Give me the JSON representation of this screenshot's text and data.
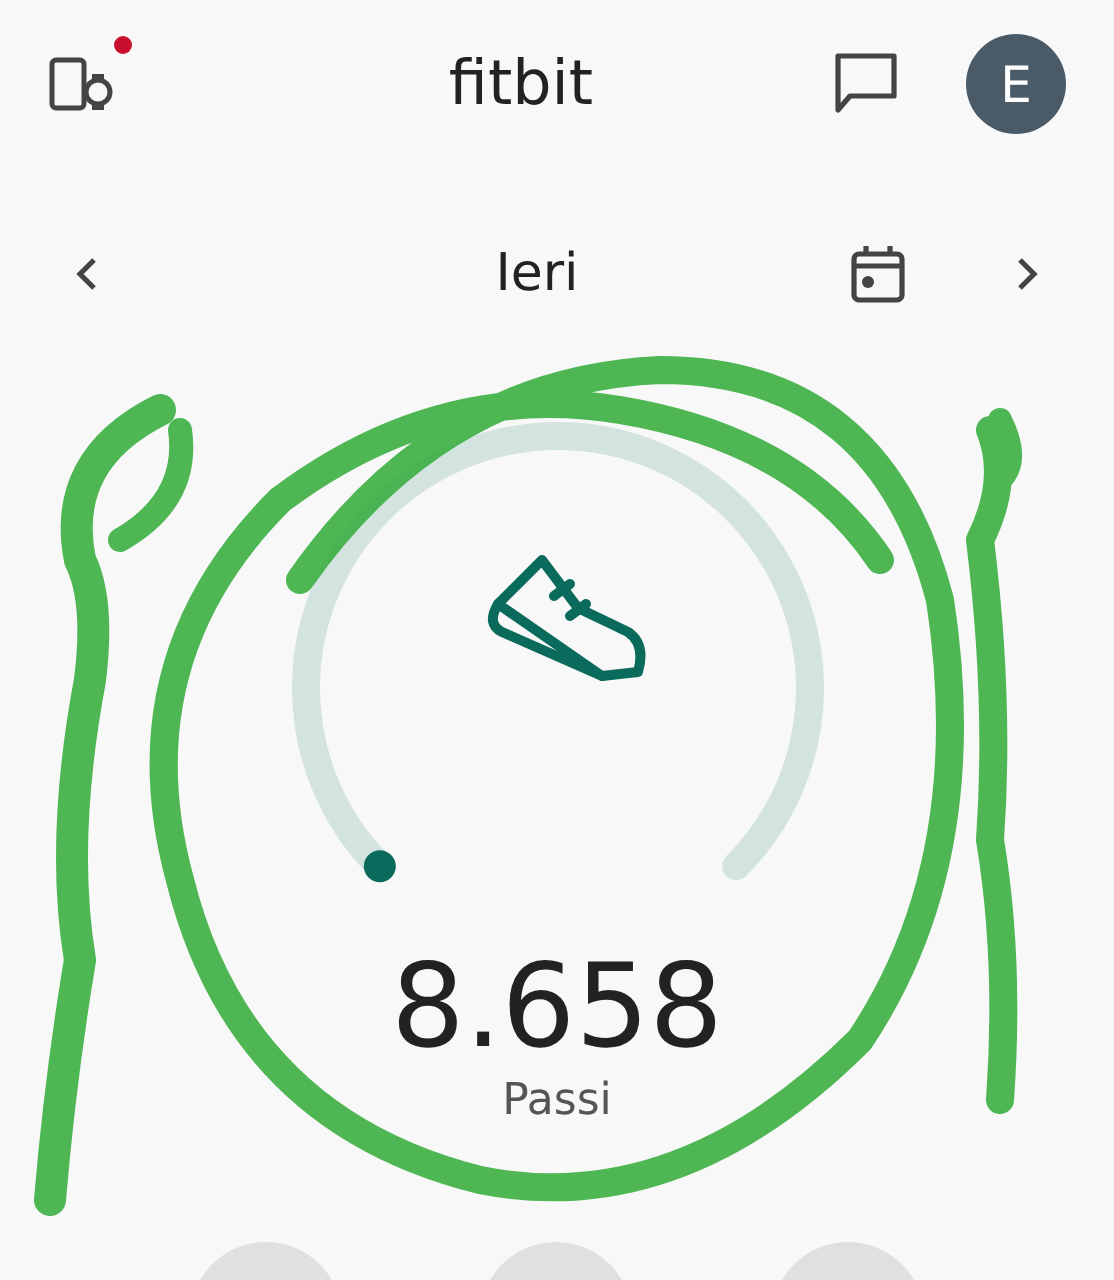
{
  "header": {
    "title": "fitbit",
    "device_alert": true,
    "avatar": "E"
  },
  "date_nav": {
    "label": "Ieri"
  },
  "steps": {
    "value": "8.658",
    "unit": "Passi"
  },
  "scribble": true
}
